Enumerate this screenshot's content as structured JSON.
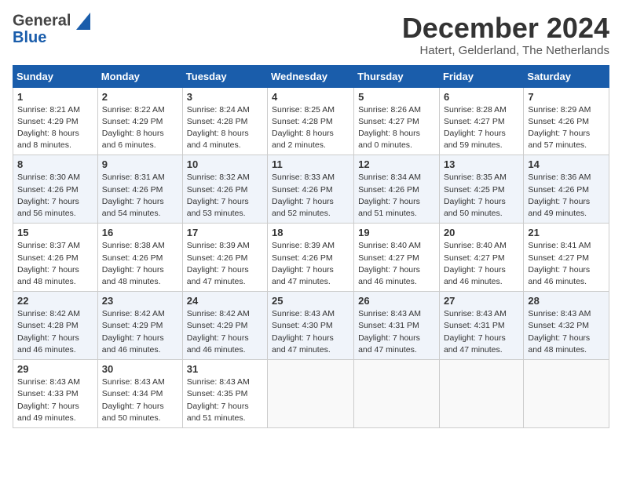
{
  "header": {
    "logo_general": "General",
    "logo_blue": "Blue",
    "month_title": "December 2024",
    "subtitle": "Hatert, Gelderland, The Netherlands"
  },
  "weekdays": [
    "Sunday",
    "Monday",
    "Tuesday",
    "Wednesday",
    "Thursday",
    "Friday",
    "Saturday"
  ],
  "weeks": [
    [
      {
        "day": "1",
        "sunrise": "8:21 AM",
        "sunset": "4:29 PM",
        "daylight": "8 hours and 8 minutes."
      },
      {
        "day": "2",
        "sunrise": "8:22 AM",
        "sunset": "4:29 PM",
        "daylight": "8 hours and 6 minutes."
      },
      {
        "day": "3",
        "sunrise": "8:24 AM",
        "sunset": "4:28 PM",
        "daylight": "8 hours and 4 minutes."
      },
      {
        "day": "4",
        "sunrise": "8:25 AM",
        "sunset": "4:28 PM",
        "daylight": "8 hours and 2 minutes."
      },
      {
        "day": "5",
        "sunrise": "8:26 AM",
        "sunset": "4:27 PM",
        "daylight": "8 hours and 0 minutes."
      },
      {
        "day": "6",
        "sunrise": "8:28 AM",
        "sunset": "4:27 PM",
        "daylight": "7 hours and 59 minutes."
      },
      {
        "day": "7",
        "sunrise": "8:29 AM",
        "sunset": "4:26 PM",
        "daylight": "7 hours and 57 minutes."
      }
    ],
    [
      {
        "day": "8",
        "sunrise": "8:30 AM",
        "sunset": "4:26 PM",
        "daylight": "7 hours and 56 minutes."
      },
      {
        "day": "9",
        "sunrise": "8:31 AM",
        "sunset": "4:26 PM",
        "daylight": "7 hours and 54 minutes."
      },
      {
        "day": "10",
        "sunrise": "8:32 AM",
        "sunset": "4:26 PM",
        "daylight": "7 hours and 53 minutes."
      },
      {
        "day": "11",
        "sunrise": "8:33 AM",
        "sunset": "4:26 PM",
        "daylight": "7 hours and 52 minutes."
      },
      {
        "day": "12",
        "sunrise": "8:34 AM",
        "sunset": "4:26 PM",
        "daylight": "7 hours and 51 minutes."
      },
      {
        "day": "13",
        "sunrise": "8:35 AM",
        "sunset": "4:25 PM",
        "daylight": "7 hours and 50 minutes."
      },
      {
        "day": "14",
        "sunrise": "8:36 AM",
        "sunset": "4:26 PM",
        "daylight": "7 hours and 49 minutes."
      }
    ],
    [
      {
        "day": "15",
        "sunrise": "8:37 AM",
        "sunset": "4:26 PM",
        "daylight": "7 hours and 48 minutes."
      },
      {
        "day": "16",
        "sunrise": "8:38 AM",
        "sunset": "4:26 PM",
        "daylight": "7 hours and 48 minutes."
      },
      {
        "day": "17",
        "sunrise": "8:39 AM",
        "sunset": "4:26 PM",
        "daylight": "7 hours and 47 minutes."
      },
      {
        "day": "18",
        "sunrise": "8:39 AM",
        "sunset": "4:26 PM",
        "daylight": "7 hours and 47 minutes."
      },
      {
        "day": "19",
        "sunrise": "8:40 AM",
        "sunset": "4:27 PM",
        "daylight": "7 hours and 46 minutes."
      },
      {
        "day": "20",
        "sunrise": "8:40 AM",
        "sunset": "4:27 PM",
        "daylight": "7 hours and 46 minutes."
      },
      {
        "day": "21",
        "sunrise": "8:41 AM",
        "sunset": "4:27 PM",
        "daylight": "7 hours and 46 minutes."
      }
    ],
    [
      {
        "day": "22",
        "sunrise": "8:42 AM",
        "sunset": "4:28 PM",
        "daylight": "7 hours and 46 minutes."
      },
      {
        "day": "23",
        "sunrise": "8:42 AM",
        "sunset": "4:29 PM",
        "daylight": "7 hours and 46 minutes."
      },
      {
        "day": "24",
        "sunrise": "8:42 AM",
        "sunset": "4:29 PM",
        "daylight": "7 hours and 46 minutes."
      },
      {
        "day": "25",
        "sunrise": "8:43 AM",
        "sunset": "4:30 PM",
        "daylight": "7 hours and 47 minutes."
      },
      {
        "day": "26",
        "sunrise": "8:43 AM",
        "sunset": "4:31 PM",
        "daylight": "7 hours and 47 minutes."
      },
      {
        "day": "27",
        "sunrise": "8:43 AM",
        "sunset": "4:31 PM",
        "daylight": "7 hours and 47 minutes."
      },
      {
        "day": "28",
        "sunrise": "8:43 AM",
        "sunset": "4:32 PM",
        "daylight": "7 hours and 48 minutes."
      }
    ],
    [
      {
        "day": "29",
        "sunrise": "8:43 AM",
        "sunset": "4:33 PM",
        "daylight": "7 hours and 49 minutes."
      },
      {
        "day": "30",
        "sunrise": "8:43 AM",
        "sunset": "4:34 PM",
        "daylight": "7 hours and 50 minutes."
      },
      {
        "day": "31",
        "sunrise": "8:43 AM",
        "sunset": "4:35 PM",
        "daylight": "7 hours and 51 minutes."
      },
      null,
      null,
      null,
      null
    ]
  ]
}
